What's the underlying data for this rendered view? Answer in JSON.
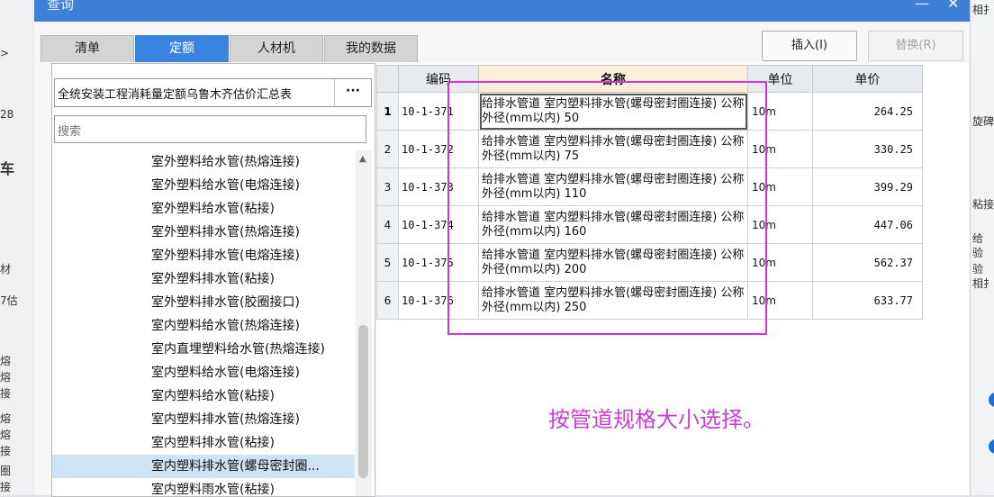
{
  "dialog": {
    "title": "查询",
    "controls": {
      "minimize": "—",
      "close": "✕"
    }
  },
  "tabs": [
    {
      "label": "清单",
      "active": false
    },
    {
      "label": "定额",
      "active": true
    },
    {
      "label": "人材机",
      "active": false
    },
    {
      "label": "我的数据",
      "active": false
    }
  ],
  "toolbar": {
    "insert_label": "插入(I)",
    "replace_label": "替换(R)"
  },
  "library": {
    "selected": "全统安装工程消耗量定额乌鲁木齐估价汇总表",
    "more_label": "···"
  },
  "search": {
    "placeholder": "搜索"
  },
  "tree": {
    "items": [
      "室外塑料给水管(热熔连接)",
      "室外塑料给水管(电熔连接)",
      "室外塑料给水管(粘接)",
      "室外塑料排水管(热熔连接)",
      "室外塑料排水管(电熔连接)",
      "室外塑料排水管(粘接)",
      "室外塑料排水管(胶圈接口)",
      "室内塑料给水管(热熔连接)",
      "室内直埋塑料给水管(热熔连接)",
      "室内塑料给水管(电熔连接)",
      "室内塑料给水管(粘接)",
      "室内塑料排水管(热熔连接)",
      "室内塑料排水管(粘接)",
      "室内塑料排水管(螺母密封圈...",
      "室内塑料雨水管(粘接)"
    ],
    "selected_index": 13
  },
  "grid": {
    "headers": {
      "code": "编码",
      "name": "名称",
      "unit": "单位",
      "price": "单价"
    },
    "current_row": 0,
    "rows": [
      {
        "index": "1",
        "code": "10-1-371",
        "name": "给排水管道 室内塑料排水管(螺母密封圈连接) 公称外径(mm以内) 50",
        "unit": "10m",
        "price": "264.25"
      },
      {
        "index": "2",
        "code": "10-1-372",
        "name": "给排水管道 室内塑料排水管(螺母密封圈连接) 公称外径(mm以内) 75",
        "unit": "10m",
        "price": "330.25"
      },
      {
        "index": "3",
        "code": "10-1-373",
        "name": "给排水管道 室内塑料排水管(螺母密封圈连接) 公称外径(mm以内) 110",
        "unit": "10m",
        "price": "399.29"
      },
      {
        "index": "4",
        "code": "10-1-374",
        "name": "给排水管道 室内塑料排水管(螺母密封圈连接) 公称外径(mm以内) 160",
        "unit": "10m",
        "price": "447.06"
      },
      {
        "index": "5",
        "code": "10-1-375",
        "name": "给排水管道 室内塑料排水管(螺母密封圈连接) 公称外径(mm以内) 200",
        "unit": "10m",
        "price": "562.37"
      },
      {
        "index": "6",
        "code": "10-1-376",
        "name": "给排水管道 室内塑料排水管(螺母密封圈连接) 公称外径(mm以内) 250",
        "unit": "10m",
        "price": "633.77"
      }
    ]
  },
  "annotation": {
    "text": "按管道规格大小选择。",
    "color": "#c840d2"
  },
  "background": {
    "left_fragments": [
      ">",
      "28",
      "车",
      "材",
      "7估",
      "熔",
      "熔",
      "接",
      "熔",
      "熔",
      "接",
      "圈",
      "接"
    ],
    "right_fragments": [
      "相扌",
      "旋碑",
      "粘接",
      "给",
      "验",
      "验",
      "相扌"
    ]
  },
  "colors": {
    "accent": "#3a84de",
    "title_bar": "#3f7fd6",
    "highlight_box": "#d533d5"
  }
}
